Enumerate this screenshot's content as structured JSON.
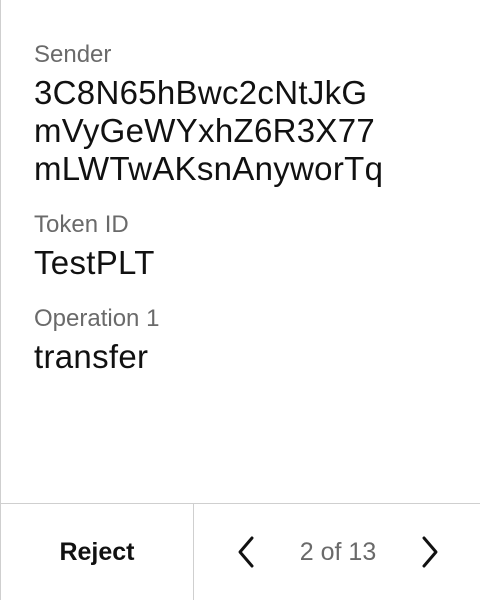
{
  "fields": {
    "sender": {
      "label": "Sender",
      "value_lines": [
        "3C8N65hBwc2cNtJkG",
        "mVyGeWYxhZ6R3X77",
        "mLWTwAKsnAnyworTq"
      ]
    },
    "token_id": {
      "label": "Token ID",
      "value": "TestPLT"
    },
    "operation_1": {
      "label": "Operation 1",
      "value": "transfer"
    }
  },
  "footer": {
    "reject_label": "Reject",
    "page_indicator": "2 of 13",
    "prev_icon": "chevron-left-icon",
    "next_icon": "chevron-right-icon"
  }
}
